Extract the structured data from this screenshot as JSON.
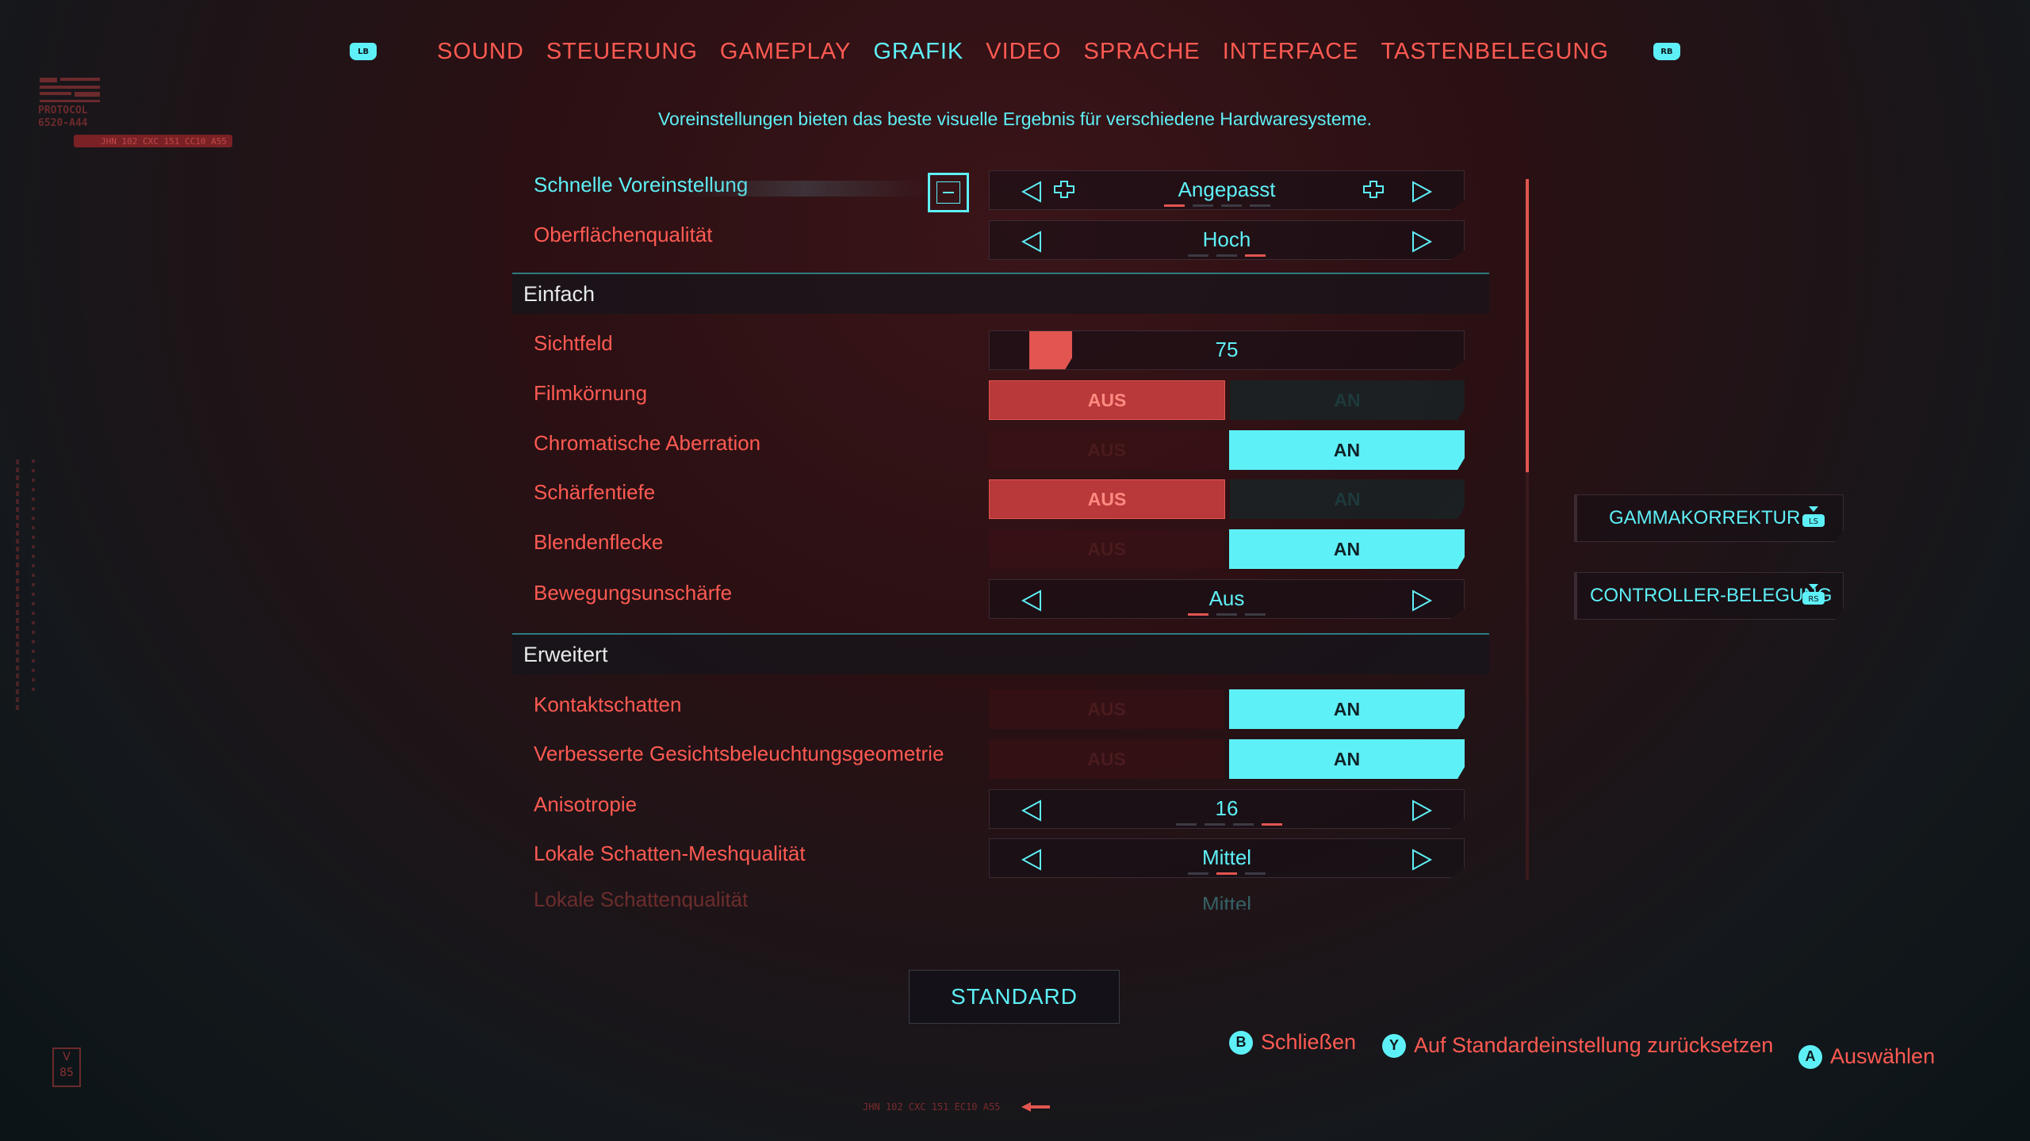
{
  "tabs": {
    "lb": "LB",
    "rb": "RB",
    "items": [
      "SOUND",
      "STEUERUNG",
      "GAMEPLAY",
      "GRAFIK",
      "VIDEO",
      "SPRACHE",
      "INTERFACE",
      "TASTENBELEGUNG"
    ],
    "active": "GRAFIK"
  },
  "subtitle": "Voreinstellungen bieten das beste visuelle Ergebnis für verschiedene Hardwaresysteme.",
  "deco": {
    "protocol": "PROTOCOL",
    "code": "6520-A44",
    "bar": "JHN 102 CXC 151 CC10 A55",
    "bottom_code": "JHN 102 CXC 151 EC10 A55",
    "badge_v": "V",
    "badge_n": "85"
  },
  "rows": {
    "quick_preset": {
      "label": "Schnelle Voreinstellung",
      "value": "Angepasst"
    },
    "texture_quality": {
      "label": "Oberflächenqualität",
      "value": "Hoch"
    },
    "section_basic": "Einfach",
    "fov": {
      "label": "Sichtfeld",
      "value": "75",
      "level": 0.1
    },
    "film_grain": {
      "label": "Filmkörnung",
      "off": "AUS",
      "on": "AN",
      "state": "AUS"
    },
    "chromatic": {
      "label": "Chromatische Aberration",
      "off": "AUS",
      "on": "AN",
      "state": "AN"
    },
    "dof": {
      "label": "Schärfentiefe",
      "off": "AUS",
      "on": "AN",
      "state": "AUS"
    },
    "lens_flare": {
      "label": "Blendenflecke",
      "off": "AUS",
      "on": "AN",
      "state": "AN"
    },
    "motion_blur": {
      "label": "Bewegungsunschärfe",
      "value": "Aus"
    },
    "section_advanced": "Erweitert",
    "contact_shadows": {
      "label": "Kontaktschatten",
      "off": "AUS",
      "on": "AN",
      "state": "AN"
    },
    "face_lighting": {
      "label": "Verbesserte Gesichtsbeleuchtungsgeometrie",
      "off": "AUS",
      "on": "AN",
      "state": "AN"
    },
    "anisotropy": {
      "label": "Anisotropie",
      "value": "16"
    },
    "local_shadow_mesh": {
      "label": "Lokale Schatten-Meshqualität",
      "value": "Mittel"
    },
    "local_shadow_quality": {
      "label": "Lokale Schattenqualität",
      "value": "Mittel"
    }
  },
  "side": {
    "gamma": {
      "label": "GAMMAKORREKTUR",
      "key": "LS"
    },
    "controller": {
      "label": "CONTROLLER-BELEGUNG",
      "key": "RS"
    }
  },
  "standard_button": "STANDARD",
  "hints": {
    "close": {
      "key": "B",
      "label": "Schließen"
    },
    "reset": {
      "key": "Y",
      "label": "Auf Standardeinstellung zurücksetzen"
    },
    "select": {
      "key": "A",
      "label": "Auswählen"
    }
  },
  "colors": {
    "red": "#ff5a52",
    "cyan": "#5ef0f7",
    "dark_red": "#b9383a"
  }
}
